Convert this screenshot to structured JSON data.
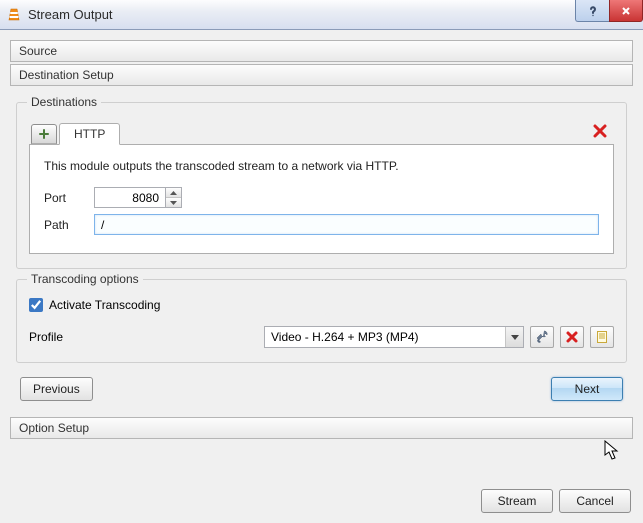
{
  "window": {
    "title": "Stream Output"
  },
  "sections": {
    "source": "Source",
    "destination_setup": "Destination Setup",
    "option_setup": "Option Setup"
  },
  "destinations": {
    "group_label": "Destinations",
    "active_tab": "HTTP",
    "description": "This module outputs the transcoded stream to a network via HTTP.",
    "port_label": "Port",
    "port_value": "8080",
    "path_label": "Path",
    "path_value": "/"
  },
  "transcoding": {
    "group_label": "Transcoding options",
    "activate_label": "Activate Transcoding",
    "activate_checked": true,
    "profile_label": "Profile",
    "profile_value": "Video - H.264 + MP3 (MP4)"
  },
  "nav": {
    "previous": "Previous",
    "next": "Next"
  },
  "footer": {
    "stream": "Stream",
    "cancel": "Cancel"
  },
  "icons": {
    "add_tab": "plus-icon",
    "delete_tab": "x-red-icon",
    "tools": "wrench-icon",
    "delete_profile": "x-red-icon",
    "new_profile": "document-icon"
  }
}
